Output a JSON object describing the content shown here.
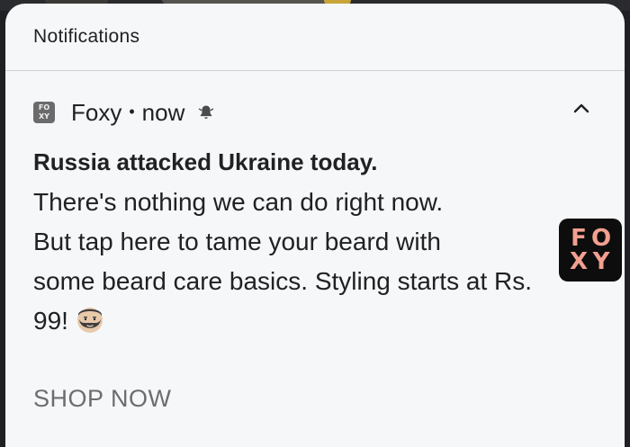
{
  "shade": {
    "header_title": "Notifications"
  },
  "notification": {
    "app_icon_letters": [
      "FO",
      "XY"
    ],
    "app_name": "Foxy",
    "separator": "•",
    "time": "now",
    "bell_icon": "bell-alert-icon",
    "expand_icon": "chevron-up-icon",
    "title": "Russia attacked Ukraine today.",
    "body_lines": [
      "There's nothing we can do right now.",
      "But tap here to tame your beard with",
      "some beard care basics. Styling starts at Rs.",
      "99!"
    ],
    "emoji": "bearded-man-emoji",
    "thumbnail_letters": [
      "F",
      "O",
      "X",
      "Y"
    ],
    "action_label": "SHOP NOW"
  },
  "colors": {
    "shade_bg": "#f6f7f9",
    "text_primary": "#202124",
    "action_text": "#6b6d70",
    "thumbnail_bg": "#0d0d0d",
    "thumbnail_text": "#f2a090"
  }
}
